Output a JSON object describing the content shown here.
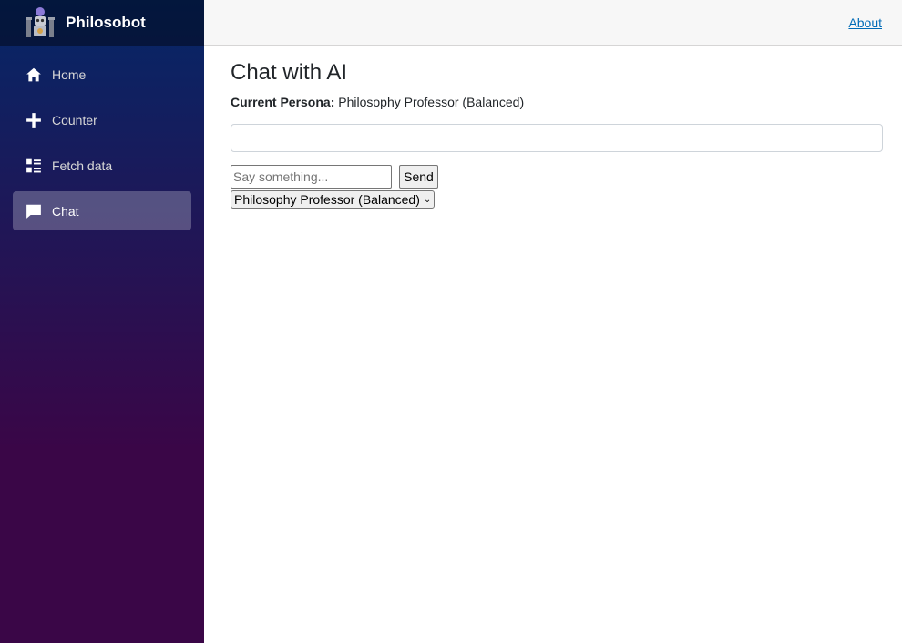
{
  "brand": {
    "name": "Philosobot",
    "logo_icon": "robot-philosopher-logo"
  },
  "nav": {
    "items": [
      {
        "label": "Home",
        "icon": "home-icon"
      },
      {
        "label": "Counter",
        "icon": "plus-icon"
      },
      {
        "label": "Fetch data",
        "icon": "list-icon"
      },
      {
        "label": "Chat",
        "icon": "chat-icon",
        "active": true
      }
    ]
  },
  "top_row": {
    "about_label": "About"
  },
  "main": {
    "title": "Chat with AI",
    "persona_label": "Current Persona:",
    "persona_value": "Philosophy Professor (Balanced)",
    "chat_log": "",
    "input_placeholder": "Say something...",
    "input_value": "",
    "send_label": "Send",
    "persona_select_value": "Philosophy Professor (Balanced)"
  },
  "colors": {
    "sidebar_top": "#052767",
    "sidebar_bottom": "#3a0647",
    "link": "#006bb7"
  }
}
